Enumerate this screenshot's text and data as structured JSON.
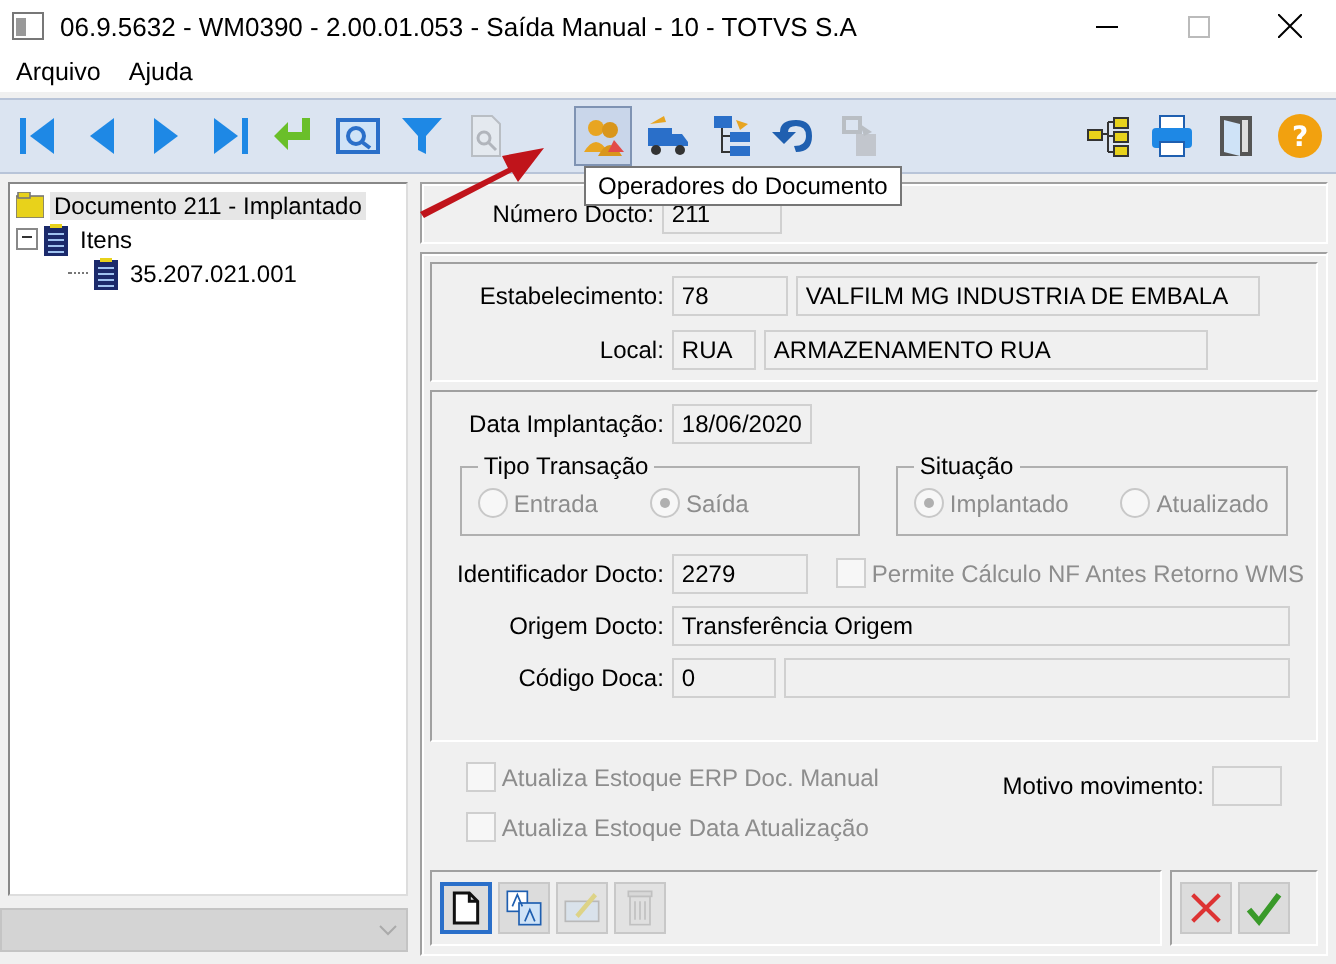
{
  "window": {
    "title": "06.9.5632 - WM0390 - 2.00.01.053 - Saída Manual - 10 - TOTVS S.A"
  },
  "menu": [
    "Arquivo",
    "Ajuda"
  ],
  "toolbar": {
    "navigation": [
      {
        "highlighted": false,
        "disabled": false
      },
      {
        "highlighted": false,
        "disabled": false
      },
      {
        "highlighted": false,
        "disabled": false
      },
      {
        "highlighted": false,
        "disabled": false
      },
      {
        "highlighted": false,
        "disabled": false
      },
      {
        "highlighted": false,
        "disabled": false
      },
      {
        "highlighted": false,
        "disabled": false
      },
      {
        "highlighted": false,
        "disabled": true
      }
    ],
    "document": [
      {
        "highlighted": true,
        "disabled": false
      },
      {
        "highlighted": false,
        "disabled": false
      },
      {
        "highlighted": false,
        "disabled": false
      },
      {
        "highlighted": false,
        "disabled": false
      },
      {
        "highlighted": false,
        "disabled": true
      }
    ],
    "utility": [
      {
        "highlighted": false,
        "disabled": false
      },
      {
        "highlighted": false,
        "disabled": false
      },
      {
        "highlighted": false,
        "disabled": false
      },
      {
        "highlighted": false,
        "disabled": false
      }
    ]
  },
  "help_glyph": "?",
  "tooltip": "Operadores do Documento",
  "tree": [
    {
      "label": "Documento 211 - Implantado",
      "selected": true,
      "children": [
        {
          "label": "Itens",
          "selected": false,
          "expanded": true,
          "children": [
            {
              "label": "35.207.021.001",
              "selected": false
            }
          ]
        }
      ]
    }
  ],
  "form": {
    "numero": {
      "label": "Número Docto:",
      "value": "211"
    },
    "estabelecimento": {
      "label": "Estabelecimento:",
      "code": "78",
      "name": "VALFILM MG INDUSTRIA DE EMBALA"
    },
    "local": {
      "label": "Local:",
      "code": "RUA",
      "name": "ARMAZENAMENTO RUA"
    },
    "data": {
      "label": "Data Implantação:",
      "value": "18/06/2020"
    },
    "tipo": {
      "title": "Tipo Transação",
      "options": [
        {
          "label": "Entrada",
          "selected": false,
          "disabled": true
        },
        {
          "label": "Saída",
          "selected": true,
          "disabled": true
        }
      ]
    },
    "situacao": {
      "title": "Situação",
      "options": [
        {
          "label": "Implantado",
          "selected": true,
          "disabled": true
        },
        {
          "label": "Atualizado",
          "selected": false,
          "disabled": true
        }
      ]
    },
    "identificador": {
      "label": "Identificador Docto:",
      "value": "2279"
    },
    "permite": {
      "label": "Permite Cálculo NF Antes Retorno WMS",
      "checked": false,
      "disabled": true
    },
    "origem": {
      "label": "Origem Docto:",
      "value": "Transferência Origem"
    },
    "codigo": {
      "label": "Código Doca:",
      "code": "0"
    },
    "options": [
      {
        "label": "Atualiza Estoque ERP Doc. Manual",
        "checked": false,
        "disabled": true
      },
      {
        "label": "Atualiza Estoque Data Atualização",
        "checked": false,
        "disabled": true
      }
    ],
    "motivo": {
      "label": "Motivo movimento:"
    }
  },
  "bottom_buttons": {
    "left": [
      {
        "focused": true,
        "disabled": false
      },
      {
        "focused": false,
        "disabled": false
      },
      {
        "focused": false,
        "disabled": true
      },
      {
        "focused": false,
        "disabled": true
      }
    ],
    "right": [
      {
        "focused": false,
        "disabled": false
      },
      {
        "focused": false,
        "disabled": false
      }
    ]
  }
}
